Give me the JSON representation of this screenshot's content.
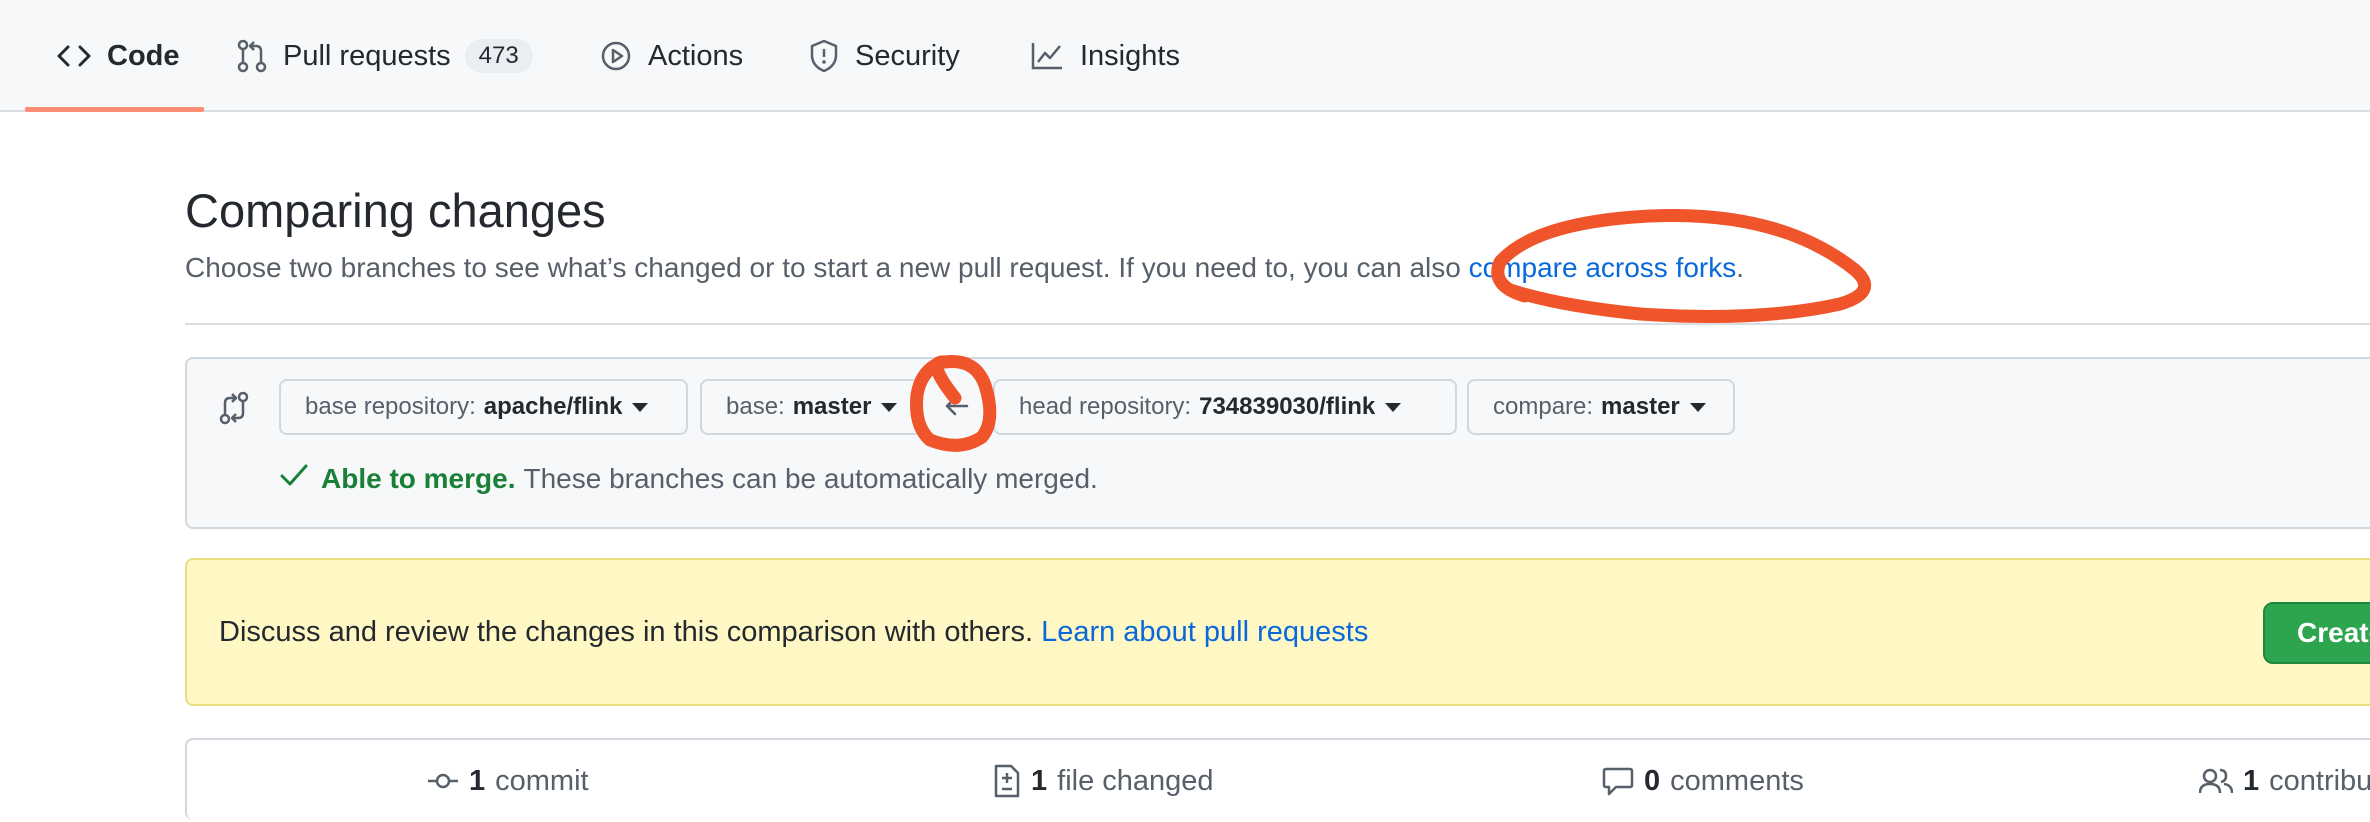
{
  "nav": {
    "tabs": [
      {
        "label": "Code",
        "icon": "code-icon",
        "active": true
      },
      {
        "label": "Pull requests",
        "icon": "git-pull-request-icon",
        "count": "473"
      },
      {
        "label": "Actions",
        "icon": "play-icon"
      },
      {
        "label": "Security",
        "icon": "shield-icon"
      },
      {
        "label": "Insights",
        "icon": "graph-icon"
      }
    ]
  },
  "header": {
    "title": "Comparing changes",
    "description": "Choose two branches to see what’s changed or to start a new pull request. If you need to, you can also",
    "compare_link": "compare across forks",
    "description_end": "."
  },
  "range": {
    "base_repo_label": "base repository:",
    "base_repo_value": "apache/flink",
    "base_label": "base:",
    "base_value": "master",
    "head_repo_label": "head repository:",
    "head_repo_value": "734839030/flink",
    "compare_label": "compare:",
    "compare_value": "master",
    "merge_status": "Able to merge.",
    "merge_detail": "These branches can be automatically merged."
  },
  "flash": {
    "text": "Discuss and review the changes in this comparison with others.",
    "link": "Learn about pull requests",
    "button": "Create pull request"
  },
  "stats": [
    {
      "count": "1",
      "label": "commit",
      "icon": "git-commit-icon"
    },
    {
      "count": "1",
      "label": "file changed",
      "icon": "file-diff-icon"
    },
    {
      "count": "0",
      "label": "comments",
      "icon": "comment-icon"
    },
    {
      "count": "1",
      "label": "contributor",
      "icon": "people-icon"
    }
  ],
  "colors": {
    "accent_underline": "#fd8c73",
    "link": "#0969da",
    "success": "#1a7f37",
    "button_green": "#2da44e",
    "flash_bg": "#fff8c5",
    "annotation": "#f0542a"
  }
}
